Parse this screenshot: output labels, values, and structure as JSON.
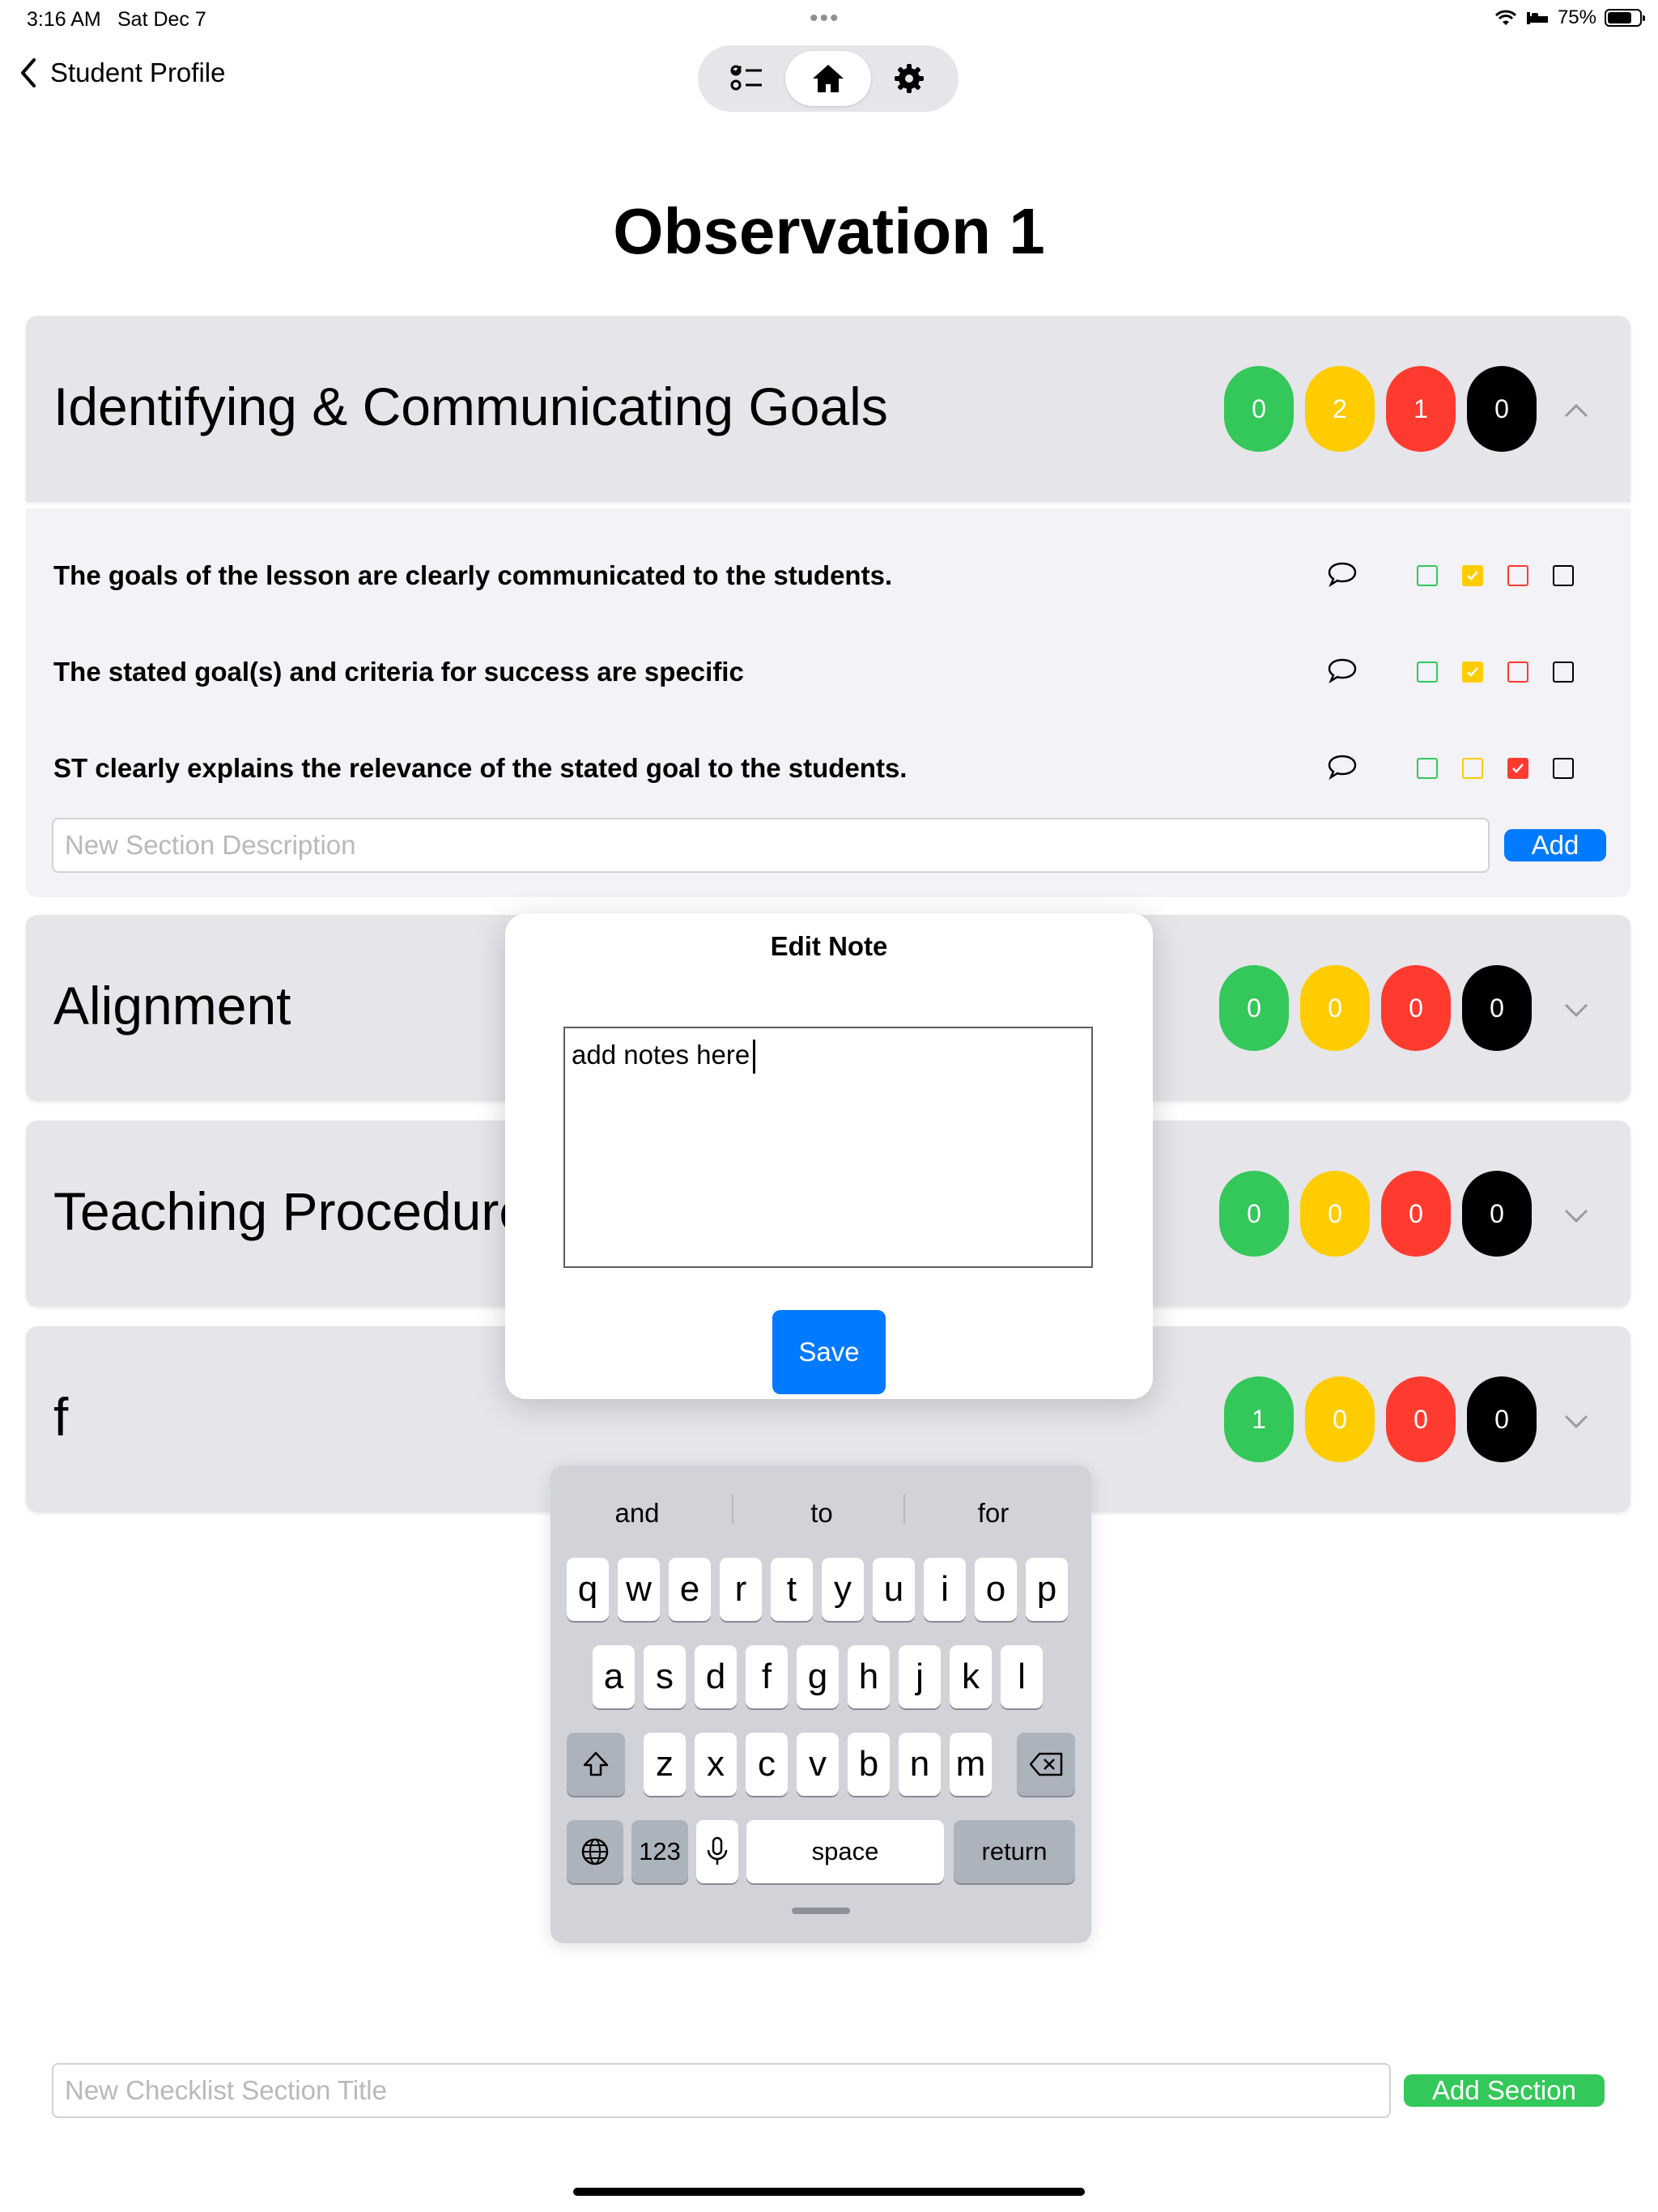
{
  "status_bar": {
    "time": "3:16 AM",
    "date": "Sat Dec 7",
    "battery": "75%",
    "battery_level": 0.75
  },
  "nav": {
    "back_label": "Student Profile"
  },
  "page": {
    "title": "Observation 1"
  },
  "sections": [
    {
      "title": "Identifying & Communicating Goals",
      "counts": [
        "0",
        "2",
        "1",
        "0"
      ],
      "expanded": true
    },
    {
      "title": "Alignment",
      "counts": [
        "0",
        "0",
        "0",
        "0"
      ],
      "expanded": false
    },
    {
      "title": "Teaching Procedures",
      "counts": [
        "0",
        "0",
        "0",
        "0"
      ],
      "expanded": false
    },
    {
      "title": "f",
      "counts": [
        "1",
        "0",
        "0",
        "0"
      ],
      "expanded": false
    }
  ],
  "items": [
    {
      "text": "The goals of the lesson are clearly communicated to the students.",
      "checked": "yellow"
    },
    {
      "text": "The stated goal(s) and criteria for success are specific",
      "checked": "yellow"
    },
    {
      "text": "ST clearly explains the relevance of the stated goal to the students.",
      "checked": "red"
    }
  ],
  "description_input": {
    "placeholder": "New Section Description",
    "button": "Add"
  },
  "modal": {
    "title": "Edit Note",
    "text": "add notes here",
    "save": "Save"
  },
  "keyboard": {
    "suggestions": [
      "and",
      "to",
      "for"
    ],
    "row1": [
      "q",
      "w",
      "e",
      "r",
      "t",
      "y",
      "u",
      "i",
      "o",
      "p"
    ],
    "row2": [
      "a",
      "s",
      "d",
      "f",
      "g",
      "h",
      "j",
      "k",
      "l"
    ],
    "row3": [
      "z",
      "x",
      "c",
      "v",
      "b",
      "n",
      "m"
    ],
    "numbers": "123",
    "space": "space",
    "return": "return"
  },
  "footer": {
    "placeholder": "New Checklist Section Title",
    "button": "Add Section"
  },
  "colors": {
    "green": "#34c759",
    "yellow": "#ffcc00",
    "red": "#ff3b30",
    "black": "#000000",
    "blue": "#007aff"
  }
}
